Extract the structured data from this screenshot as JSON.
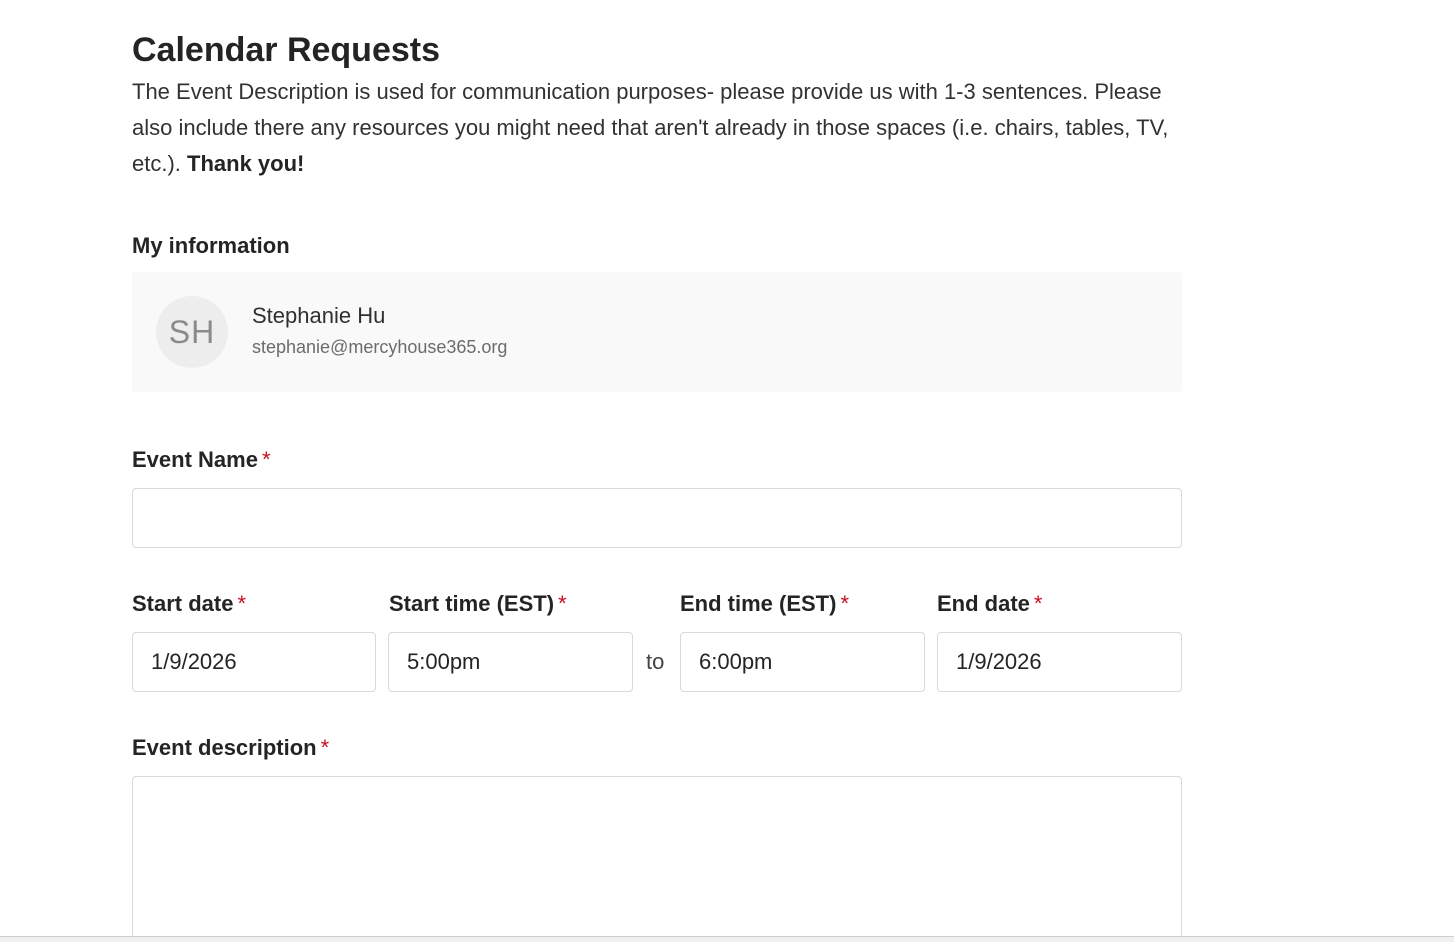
{
  "form": {
    "title": "Calendar Requests",
    "intro_text": "The Event Description is used for communication purposes- please provide us with 1-3 sentences. Please also include there any resources you might need that aren't already in those spaces (i.e. chairs, tables, TV, etc.).",
    "intro_bold": "Thank you!"
  },
  "my_information": {
    "label": "My information",
    "initials": "SH",
    "name": "Stephanie Hu",
    "email": "stephanie@mercyhouse365.org"
  },
  "event_name": {
    "label": "Event Name",
    "required_mark": "*",
    "value": ""
  },
  "schedule": {
    "start_date": {
      "label": "Start date",
      "required_mark": "*",
      "value": "1/9/2026"
    },
    "start_time": {
      "label": "Start time (EST)",
      "required_mark": "*",
      "value": "5:00pm"
    },
    "separator": "to",
    "end_time": {
      "label": "End time (EST)",
      "required_mark": "*",
      "value": "6:00pm"
    },
    "end_date": {
      "label": "End date",
      "required_mark": "*",
      "value": "1/9/2026"
    }
  },
  "event_description": {
    "label": "Event description",
    "required_mark": "*",
    "value": ""
  },
  "colors": {
    "required": "#c50f1f",
    "card_background": "#f9f9f9",
    "input_border": "#d9d9d9"
  }
}
